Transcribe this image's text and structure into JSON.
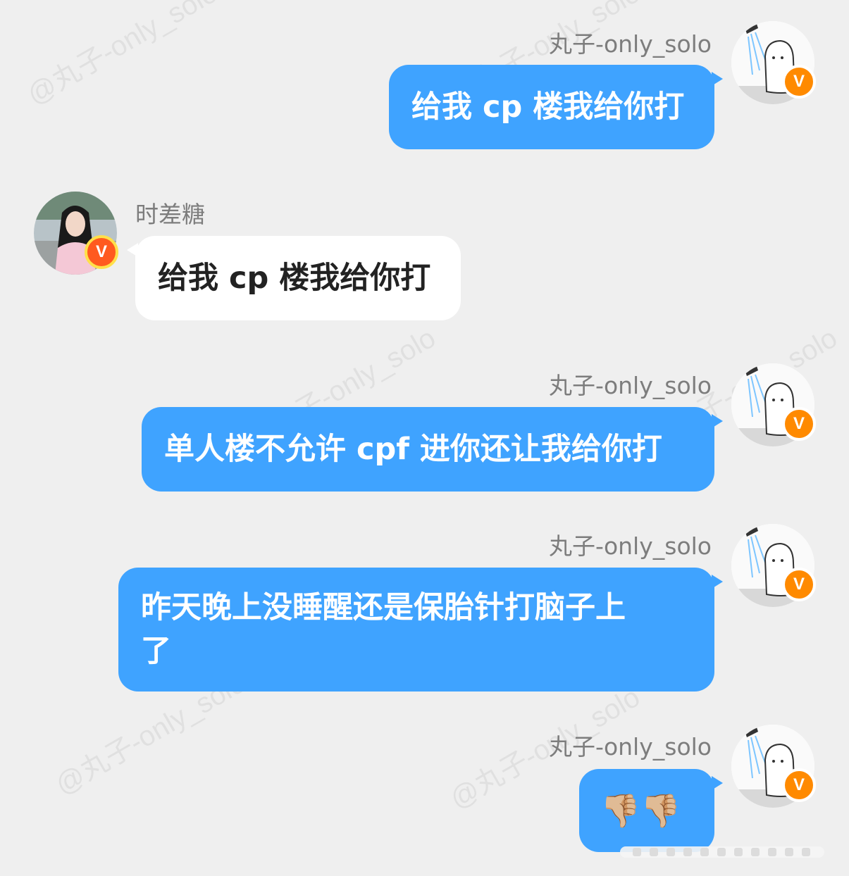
{
  "watermark": "@丸子-only_solo",
  "messages": [
    {
      "sender": "丸子-only_solo",
      "text": "给我 cp 楼我给你打",
      "side": "right"
    },
    {
      "sender": "时差糖",
      "text": "给我 cp 楼我给你打",
      "side": "left"
    },
    {
      "sender": "丸子-only_solo",
      "text": "单人楼不允许 cpf 进你还让我给你打",
      "side": "right"
    },
    {
      "sender": "丸子-only_solo",
      "text": "昨天晚上没睡醒还是保胎针打脑子上\n了",
      "side": "right"
    },
    {
      "sender": "丸子-only_solo",
      "text": "👎🏼👎🏼",
      "side": "right"
    }
  ],
  "badge": "V",
  "colors": {
    "bubble_blue": "#3fa3ff",
    "bubble_white": "#ffffff",
    "background": "#efefef",
    "badge_orange": "#ff8a00"
  }
}
